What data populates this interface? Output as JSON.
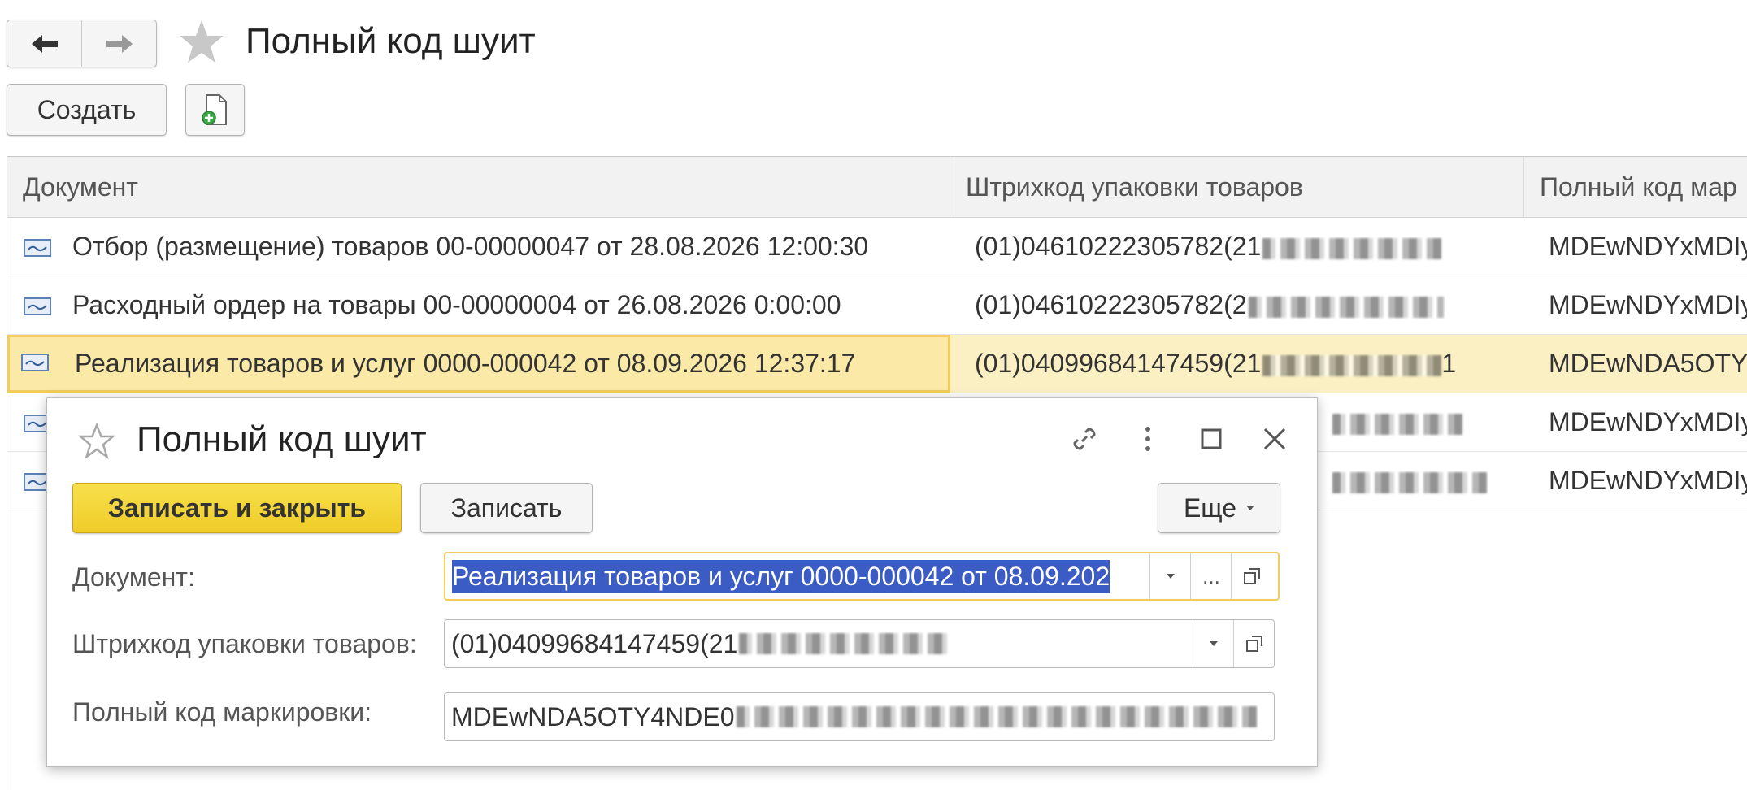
{
  "header": {
    "title": "Полный код шуит",
    "create_label": "Создать"
  },
  "table": {
    "columns": [
      "Документ",
      "Штрихкод упаковки товаров",
      "Полный код мар"
    ],
    "rows": [
      {
        "document": "Отбор (размещение) товаров 00-00000047 от 28.08.2026 12:00:30",
        "barcode": "(01)04610222305782(21",
        "full_code": "MDEwNDYxMDIy",
        "selected": false
      },
      {
        "document": "Расходный ордер на товары 00-00000004 от 26.08.2026 0:00:00",
        "barcode": "(01)04610222305782(2",
        "full_code": "MDEwNDYxMDIy",
        "selected": false
      },
      {
        "document": "Реализация товаров и услуг 0000-000042 от 08.09.2026 12:37:17",
        "barcode": "(01)04099684147459(21",
        "full_code": "MDEwNDA5OTY",
        "selected": true
      },
      {
        "document": "",
        "barcode": "",
        "full_code": "MDEwNDYxMDIy",
        "selected": false
      },
      {
        "document": "",
        "barcode": "",
        "full_code": "MDEwNDYxMDIy",
        "selected": false
      }
    ]
  },
  "dialog": {
    "title": "Полный код шуит",
    "save_close_label": "Записать и закрыть",
    "save_label": "Записать",
    "more_label": "Еще",
    "fields": {
      "document_label": "Документ:",
      "document_value": "Реализация товаров и услуг 0000-000042 от 08.09.202",
      "barcode_label": "Штрихкод упаковки товаров:",
      "barcode_value": "(01)04099684147459(21",
      "full_code_label": "Полный код маркировки:",
      "full_code_value": "MDEwNDA5OTY4NDE0"
    },
    "choice_button": "..."
  },
  "colors": {
    "selection_row": "#fbf0c4",
    "selection_border": "#f2cd5b",
    "primary_button": "#f2d438",
    "text_selection": "#3b5cc4"
  }
}
